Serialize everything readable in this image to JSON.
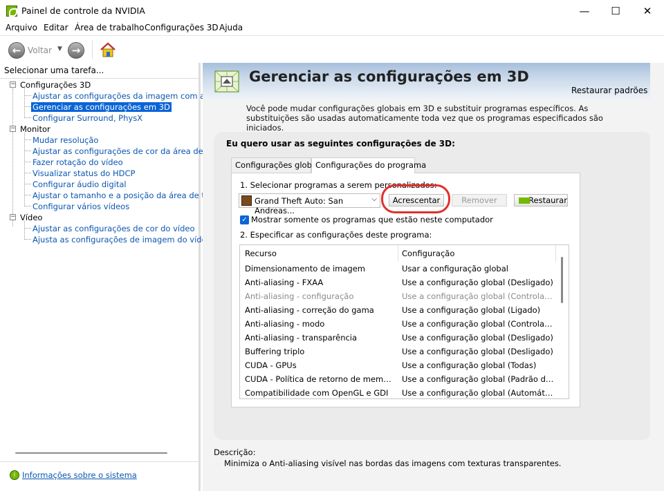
{
  "window": {
    "title": "Painel de controle da NVIDIA",
    "controls": {
      "minimize": "—",
      "maximize": "☐",
      "close": "✕"
    }
  },
  "menu": [
    "Arquivo",
    "Editar",
    "Área de trabalho",
    "Configurações 3D",
    "Ajuda"
  ],
  "toolbar": {
    "back_label": "Voltar",
    "back_icon": "back-arrow-icon",
    "forward_icon": "forward-arrow-icon",
    "home_icon": "home-icon"
  },
  "sidebar": {
    "header": "Selecionar uma tarefa...",
    "categories": [
      {
        "label": "Configurações 3D",
        "expander": "−",
        "items": [
          "Ajustar as configurações da imagem com a Visuali:",
          "Gerenciar as configurações em 3D",
          "Configurar Surround, PhysX"
        ]
      },
      {
        "label": "Monitor",
        "expander": "−",
        "items": [
          "Mudar resolução",
          "Ajustar as configurações de cor da área de trabal",
          "Fazer rotação do vídeo",
          "Visualizar status do HDCP",
          "Configurar áudio digital",
          "Ajustar o tamanho e a posição da área de trabalh",
          "Configurar vários vídeos"
        ]
      },
      {
        "label": "Vídeo",
        "expander": "−",
        "items": [
          "Ajustar as configurações de cor do vídeo",
          "Ajusta as configurações de imagem do vídeo"
        ]
      }
    ],
    "selected_item": "Gerenciar as configurações em 3D",
    "system_info": "Informações sobre o sistema"
  },
  "main": {
    "title": "Gerenciar as configurações em 3D",
    "restore_defaults": "Restaurar padrões",
    "intro": "Você pode mudar configurações globais em 3D e substituir programas específicos. As substituições são usadas automaticamente toda vez que os programas especificados são iniciados.",
    "panel_heading": "Eu quero usar as seguintes configurações de 3D:",
    "tabs": [
      {
        "label": "Configurações globais",
        "active": false
      },
      {
        "label": "Configurações do programa",
        "active": true
      }
    ],
    "step1": "1. Selecionar programas a serem personalizados:",
    "program": "Grand Theft Auto: San Andreas...",
    "add_button": "Acrescentar",
    "remove_button": "Remover",
    "restore_button": "Restaurar",
    "show_only_checked": true,
    "show_only_label": "Mostrar somente os programas que estão neste computador",
    "step2": "2. Especificar as configurações deste programa:",
    "table": {
      "headers": [
        "Recurso",
        "Configuração"
      ],
      "rows": [
        {
          "feature": "Dimensionamento de imagem",
          "setting": "Usar a configuração global",
          "dim": false
        },
        {
          "feature": "Anti-aliasing - FXAA",
          "setting": "Use a configuração global (Desligado)",
          "dim": false
        },
        {
          "feature": "Anti-aliasing - configuração",
          "setting": "Use a configuração global (Controlado por...",
          "dim": true
        },
        {
          "feature": "Anti-aliasing - correção do gama",
          "setting": "Use a configuração global (Ligado)",
          "dim": false
        },
        {
          "feature": "Anti-aliasing - modo",
          "setting": "Use a configuração global (Controlado por...",
          "dim": false
        },
        {
          "feature": "Anti-aliasing - transparência",
          "setting": "Use a configuração global (Desligado)",
          "dim": false
        },
        {
          "feature": "Buffering triplo",
          "setting": "Use a configuração global (Desligado)",
          "dim": false
        },
        {
          "feature": "CUDA - GPUs",
          "setting": "Use a configuração global (Todas)",
          "dim": false
        },
        {
          "feature": "CUDA - Política de retorno de memória do ...",
          "setting": "Use a configuração global (Padrão do driver)",
          "dim": false
        },
        {
          "feature": "Compatibilidade com OpenGL e GDI",
          "setting": "Use a configuração global (Automático)",
          "dim": false
        }
      ]
    },
    "description_label": "Descrição:",
    "description_text": "Minimiza o Anti-aliasing visível nas bordas das imagens com texturas transparentes."
  },
  "colors": {
    "selection": "#0a64d6",
    "link": "#0a56b0",
    "highlight_ring": "#e0302c",
    "nvidia_green": "#76b900"
  }
}
